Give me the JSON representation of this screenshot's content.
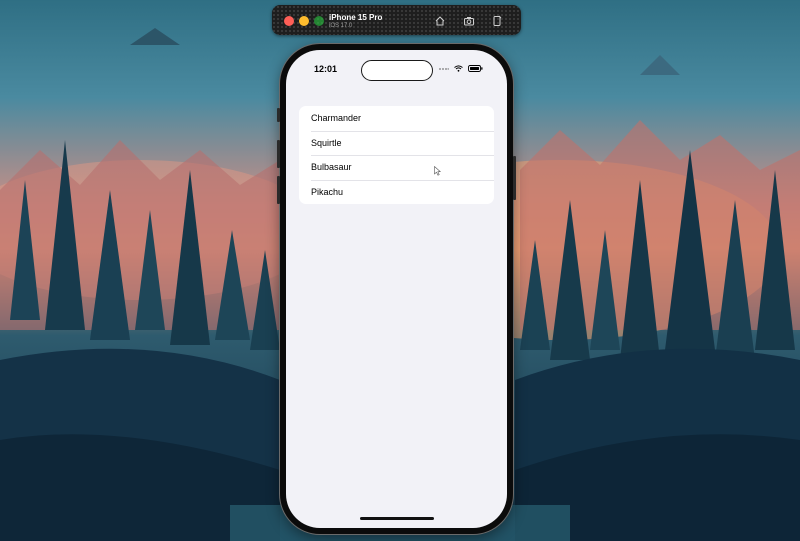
{
  "simulator": {
    "device_name": "iPhone 15 Pro",
    "os_version": "iOS 17.0"
  },
  "status_bar": {
    "time": "12:01"
  },
  "list": {
    "items": [
      {
        "label": "Charmander"
      },
      {
        "label": "Squirtle"
      },
      {
        "label": "Bulbasaur"
      },
      {
        "label": "Pikachu"
      }
    ]
  },
  "colors": {
    "screen_background": "#f2f2f7",
    "list_background": "#ffffff",
    "separator": "#e3e3e8"
  }
}
